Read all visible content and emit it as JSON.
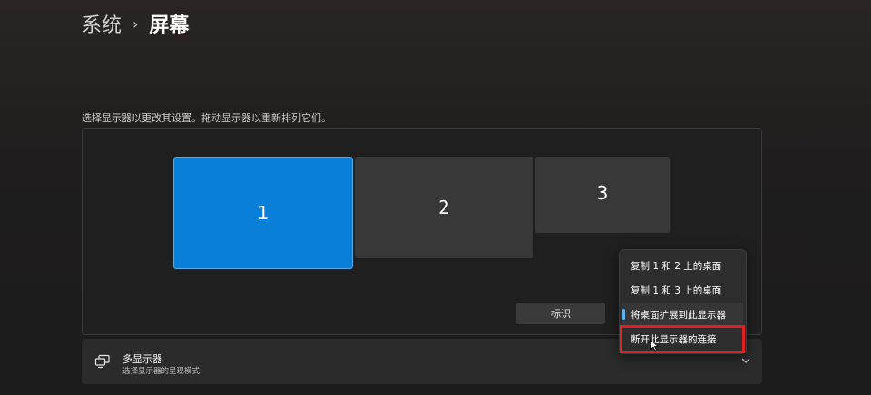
{
  "breadcrumb": {
    "parent": "系统",
    "separator": "›",
    "current": "屏幕"
  },
  "instruction": "选择显示器以更改其设置。拖动显示器以重新排列它们。",
  "monitors": [
    {
      "label": "1",
      "selected": true
    },
    {
      "label": "2",
      "selected": false
    },
    {
      "label": "3",
      "selected": false
    }
  ],
  "identify_button": "标识",
  "multi_display": {
    "icon": "multi-display-icon",
    "title": "多显示器",
    "subtitle": "选择显示器的呈现模式"
  },
  "dropdown": {
    "items": [
      {
        "label": "复制 1 和 2 上的桌面"
      },
      {
        "label": "复制 1 和 3 上的桌面"
      },
      {
        "label": "将桌面扩展到此显示器",
        "selected": true
      },
      {
        "label": "断开此显示器的连接",
        "highlighted": true
      }
    ]
  },
  "colors": {
    "accent": "#0a7fd8",
    "highlight": "#e01e24",
    "selection_indicator": "#5fb2f2"
  }
}
